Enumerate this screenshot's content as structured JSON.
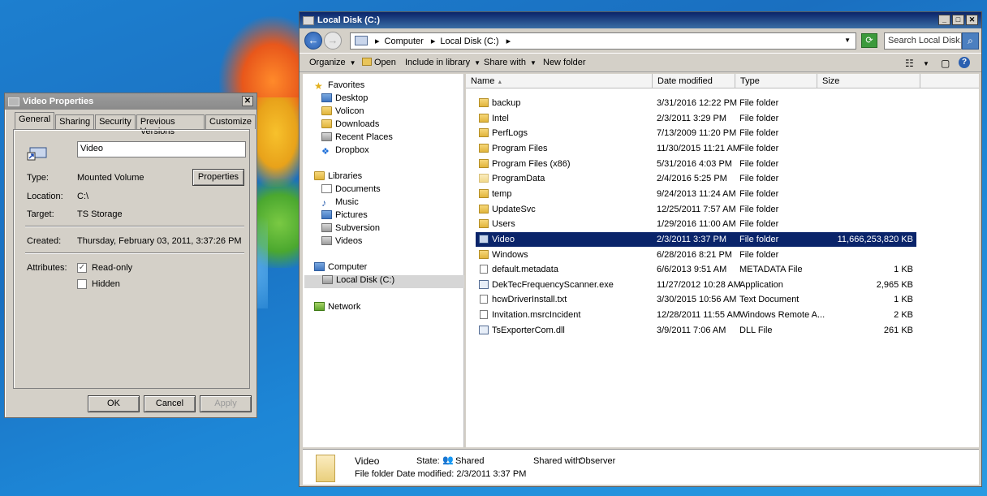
{
  "properties_dialog": {
    "title": "Video Properties",
    "close_glyph": "✕",
    "tabs": [
      "General",
      "Sharing",
      "Security",
      "Previous Versions",
      "Customize"
    ],
    "name_value": "Video",
    "type_label": "Type:",
    "type_value": "Mounted Volume",
    "properties_button": "Properties",
    "location_label": "Location:",
    "location_value": "C:\\",
    "target_label": "Target:",
    "target_value": "TS Storage",
    "created_label": "Created:",
    "created_value": "Thursday, February 03, 2011, 3:37:26 PM",
    "attributes_label": "Attributes:",
    "readonly_label": "Read-only",
    "readonly_checked": true,
    "hidden_label": "Hidden",
    "hidden_checked": false,
    "ok_label": "OK",
    "cancel_label": "Cancel",
    "apply_label": "Apply"
  },
  "explorer": {
    "title": "Local Disk (C:)",
    "window_buttons": [
      "_",
      "□",
      "✕"
    ],
    "breadcrumb": [
      "Computer",
      "Local Disk (C:)"
    ],
    "search_placeholder": "Search Local Disk...",
    "toolbar": {
      "organize": "Organize",
      "open": "Open",
      "include": "Include in library",
      "share": "Share with",
      "new_folder": "New folder"
    },
    "nav": {
      "favorites": "Favorites",
      "favorite_items": [
        "Desktop",
        "Volicon",
        "Downloads",
        "Recent Places",
        "Dropbox"
      ],
      "libraries": "Libraries",
      "library_items": [
        "Documents",
        "Music",
        "Pictures",
        "Subversion",
        "Videos"
      ],
      "computer": "Computer",
      "local_disk": "Local Disk (C:)",
      "network": "Network"
    },
    "columns": [
      "Name",
      "Date modified",
      "Type",
      "Size"
    ],
    "files": [
      {
        "name": "backup",
        "date": "3/31/2016 12:22 PM",
        "type": "File folder",
        "size": "",
        "icon": "folder"
      },
      {
        "name": "Intel",
        "date": "2/3/2011 3:29 PM",
        "type": "File folder",
        "size": "",
        "icon": "folder"
      },
      {
        "name": "PerfLogs",
        "date": "7/13/2009 11:20 PM",
        "type": "File folder",
        "size": "",
        "icon": "folder"
      },
      {
        "name": "Program Files",
        "date": "11/30/2015 11:21 AM",
        "type": "File folder",
        "size": "",
        "icon": "folder"
      },
      {
        "name": "Program Files (x86)",
        "date": "5/31/2016 4:03 PM",
        "type": "File folder",
        "size": "",
        "icon": "folder"
      },
      {
        "name": "ProgramData",
        "date": "2/4/2016 5:25 PM",
        "type": "File folder",
        "size": "",
        "icon": "folder-light"
      },
      {
        "name": "temp",
        "date": "9/24/2013 11:24 AM",
        "type": "File folder",
        "size": "",
        "icon": "folder"
      },
      {
        "name": "UpdateSvc",
        "date": "12/25/2011 7:57 AM",
        "type": "File folder",
        "size": "",
        "icon": "folder"
      },
      {
        "name": "Users",
        "date": "1/29/2016 11:00 AM",
        "type": "File folder",
        "size": "",
        "icon": "folder"
      },
      {
        "name": "Video",
        "date": "2/3/2011 3:37 PM",
        "type": "File folder",
        "size": "11,666,253,820 KB",
        "icon": "mount",
        "selected": true
      },
      {
        "name": "Windows",
        "date": "6/28/2016 8:21 PM",
        "type": "File folder",
        "size": "",
        "icon": "folder"
      },
      {
        "name": "default.metadata",
        "date": "6/6/2013 9:51 AM",
        "type": "METADATA File",
        "size": "1 KB",
        "icon": "file"
      },
      {
        "name": "DekTecFrequencyScanner.exe",
        "date": "11/27/2012 10:28 AM",
        "type": "Application",
        "size": "2,965 KB",
        "icon": "app"
      },
      {
        "name": "hcwDriverInstall.txt",
        "date": "3/30/2015 10:56 AM",
        "type": "Text Document",
        "size": "1 KB",
        "icon": "file"
      },
      {
        "name": "Invitation.msrcIncident",
        "date": "12/28/2011 11:55 AM",
        "type": "Windows Remote A...",
        "size": "2 KB",
        "icon": "file"
      },
      {
        "name": "TsExporterCom.dll",
        "date": "3/9/2011 7:06 AM",
        "type": "DLL File",
        "size": "261 KB",
        "icon": "app"
      }
    ],
    "details": {
      "name": "Video",
      "state_label": "State:",
      "state_value": "Shared",
      "shared_with_label": "Shared with:",
      "shared_with_value": "Observer",
      "type_line": "File folder Date modified: 2/3/2011 3:37 PM"
    }
  }
}
